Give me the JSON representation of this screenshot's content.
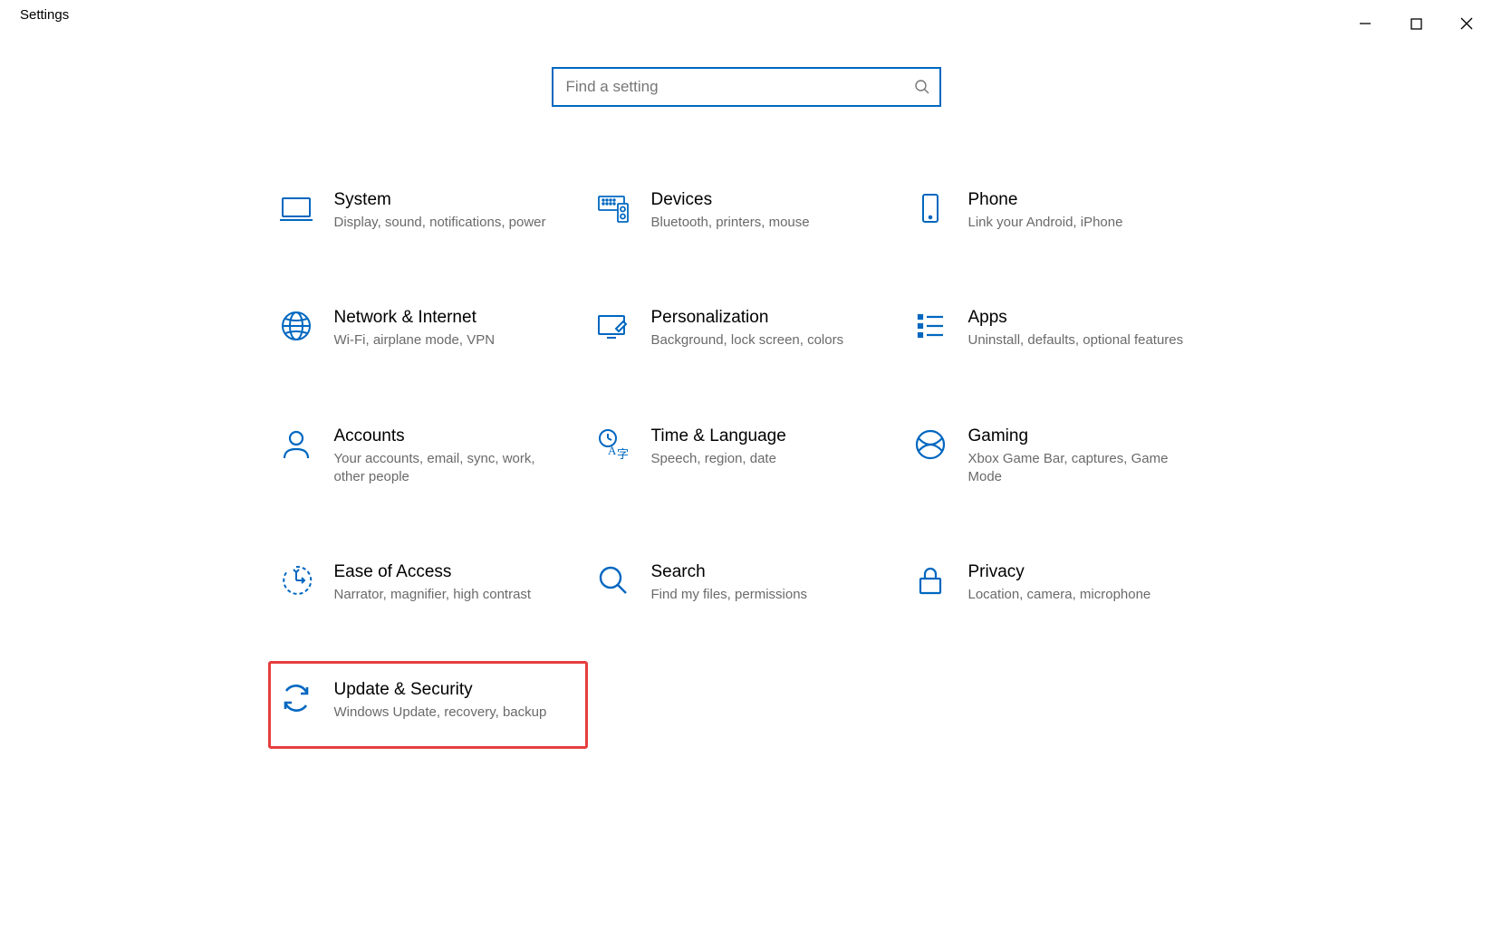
{
  "window": {
    "title": "Settings"
  },
  "search": {
    "placeholder": "Find a setting"
  },
  "categories": [
    {
      "id": "system",
      "title": "System",
      "desc": "Display, sound, notifications, power"
    },
    {
      "id": "devices",
      "title": "Devices",
      "desc": "Bluetooth, printers, mouse"
    },
    {
      "id": "phone",
      "title": "Phone",
      "desc": "Link your Android, iPhone"
    },
    {
      "id": "network",
      "title": "Network & Internet",
      "desc": "Wi-Fi, airplane mode, VPN"
    },
    {
      "id": "personalization",
      "title": "Personalization",
      "desc": "Background, lock screen, colors"
    },
    {
      "id": "apps",
      "title": "Apps",
      "desc": "Uninstall, defaults, optional features"
    },
    {
      "id": "accounts",
      "title": "Accounts",
      "desc": "Your accounts, email, sync, work, other people"
    },
    {
      "id": "time",
      "title": "Time & Language",
      "desc": "Speech, region, date"
    },
    {
      "id": "gaming",
      "title": "Gaming",
      "desc": "Xbox Game Bar, captures, Game Mode"
    },
    {
      "id": "ease",
      "title": "Ease of Access",
      "desc": "Narrator, magnifier, high contrast"
    },
    {
      "id": "search",
      "title": "Search",
      "desc": "Find my files, permissions"
    },
    {
      "id": "privacy",
      "title": "Privacy",
      "desc": "Location, camera, microphone"
    },
    {
      "id": "update",
      "title": "Update & Security",
      "desc": "Windows Update, recovery, backup",
      "highlighted": true
    }
  ],
  "colors": {
    "accent": "#0067c0",
    "highlight": "#e53e3e"
  }
}
